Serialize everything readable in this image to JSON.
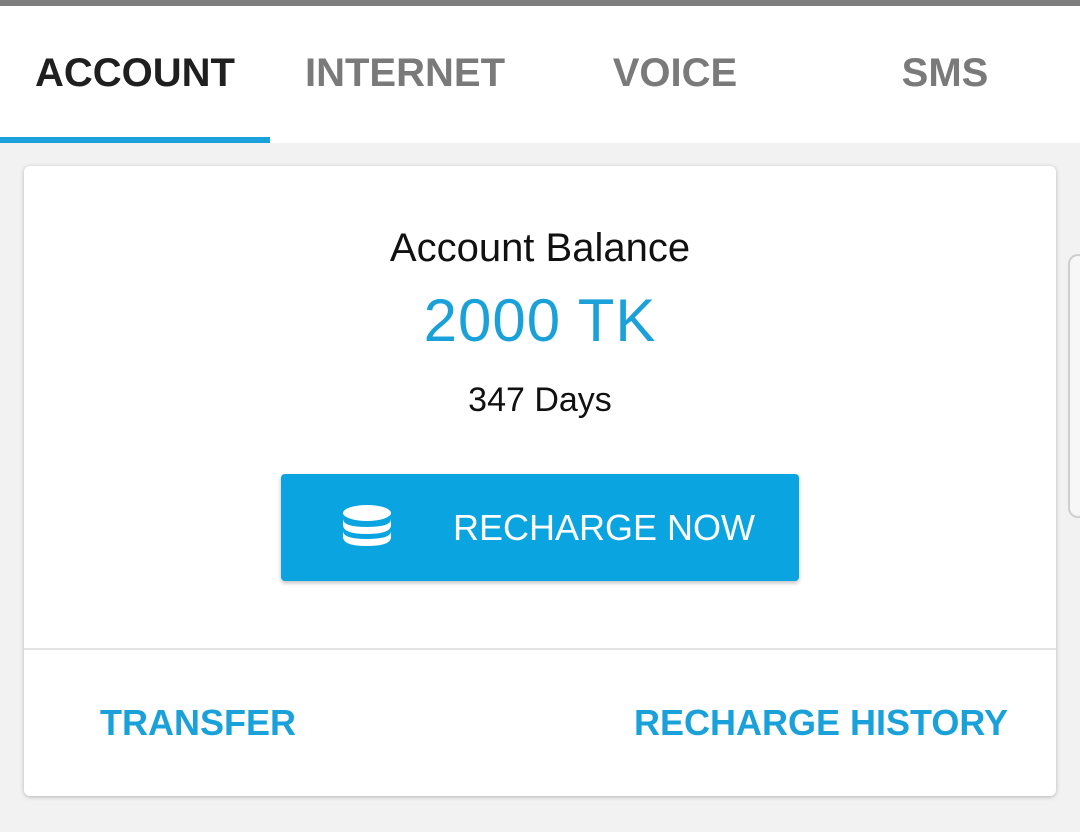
{
  "tabs": [
    {
      "label": "ACCOUNT",
      "active": true
    },
    {
      "label": "INTERNET",
      "active": false
    },
    {
      "label": "VOICE",
      "active": false
    },
    {
      "label": "SMS",
      "active": false
    }
  ],
  "account": {
    "title": "Account Balance",
    "balance": "2000 TK",
    "validity": "347 Days",
    "recharge_button": {
      "label": "RECHARGE NOW",
      "icon": "coins-icon"
    }
  },
  "actions": {
    "transfer": "TRANSFER",
    "recharge_history": "RECHARGE HISTORY"
  },
  "colors": {
    "accent": "#1ba1da",
    "button": "#0aa5e0",
    "active_tab_text": "#1f1f1f",
    "inactive_tab_text": "#7a7a7a"
  }
}
